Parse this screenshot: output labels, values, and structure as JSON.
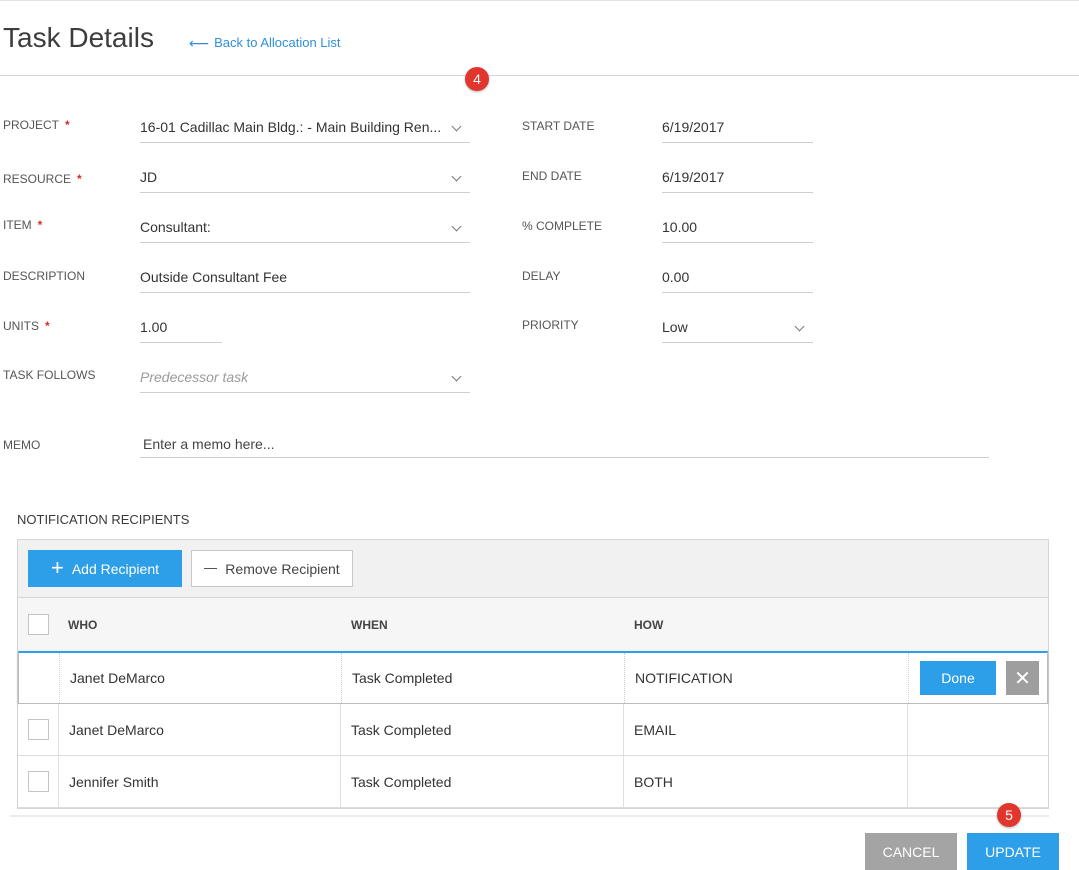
{
  "header": {
    "title": "Task Details",
    "back_link": "Back to Allocation List",
    "back_icon": "left-arrow-icon"
  },
  "markers": {
    "m4": "4",
    "m5": "5"
  },
  "form": {
    "project": {
      "label": "PROJECT",
      "required": "*",
      "value": "16-01 Cadillac Main Bldg.: - Main Building Ren..."
    },
    "resource": {
      "label": "RESOURCE",
      "required": "*",
      "value": "JD"
    },
    "item": {
      "label": "ITEM",
      "required": "*",
      "value": "Consultant:"
    },
    "description": {
      "label": "DESCRIPTION",
      "value": "Outside Consultant Fee"
    },
    "units": {
      "label": "UNITS",
      "required": "*",
      "value": "1.00"
    },
    "task_follows": {
      "label": "TASK FOLLOWS",
      "placeholder": "Predecessor task"
    },
    "start_date": {
      "label": "START DATE",
      "value": "6/19/2017"
    },
    "end_date": {
      "label": "END DATE",
      "value": "6/19/2017"
    },
    "percent_complete": {
      "label": "% COMPLETE",
      "value": "10.00"
    },
    "delay": {
      "label": "DELAY",
      "value": "0.00"
    },
    "priority": {
      "label": "PRIORITY",
      "value": "Low"
    },
    "memo": {
      "label": "MEMO",
      "placeholder": "Enter a memo here..."
    }
  },
  "recipients": {
    "title": "NOTIFICATION RECIPIENTS",
    "add_label": "Add Recipient",
    "remove_label": "Remove Recipient",
    "columns": [
      "WHO",
      "WHEN",
      "HOW"
    ],
    "rows": [
      {
        "who": "Janet DeMarco",
        "when": "Task Completed",
        "how": "NOTIFICATION"
      },
      {
        "who": "Janet DeMarco",
        "when": "Task Completed",
        "how": "EMAIL"
      },
      {
        "who": "Jennifer Smith",
        "when": "Task Completed",
        "how": "BOTH"
      }
    ],
    "done_label": "Done",
    "close_glyph": "✕"
  },
  "footer": {
    "cancel_label": "CANCEL",
    "update_label": "UPDATE"
  },
  "colors": {
    "accent": "#2d9ee8",
    "required": "#d62d2d",
    "marker": "#e0362d",
    "cancel": "#a4a4a4"
  }
}
